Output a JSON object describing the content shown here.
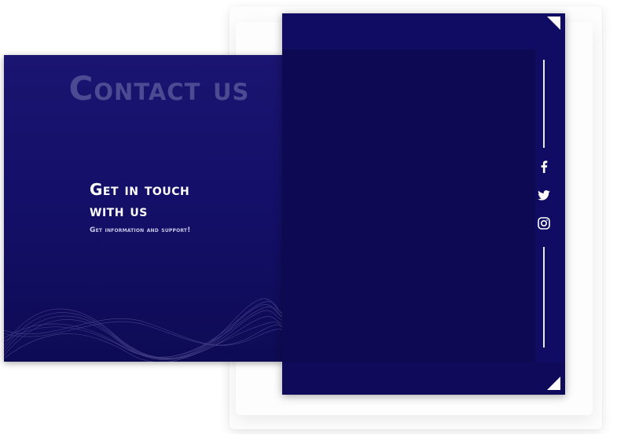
{
  "contact": {
    "title": "Contact us",
    "headline_line1": "Get in touch",
    "headline_line2": "with us",
    "subtitle": "Get information and support!"
  },
  "social": {
    "icons": [
      "facebook-icon",
      "twitter-icon",
      "instagram-icon"
    ]
  },
  "colors": {
    "panel_navy": "#14106a",
    "panel_dark": "#0d0952",
    "title_muted": "#4b4a92",
    "text_white": "#ffffff"
  }
}
